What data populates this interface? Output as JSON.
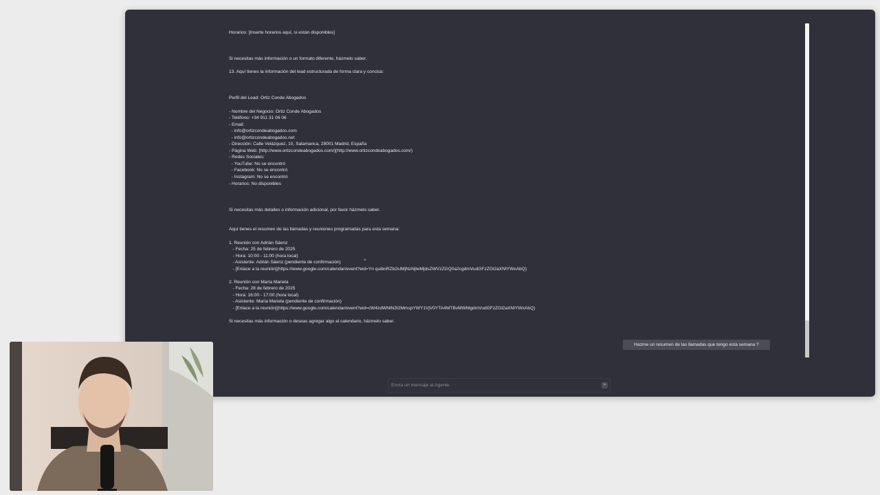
{
  "chat": {
    "messages": [
      "Horarios: [Inserte horarios aquí, si están disponibles]",
      "",
      "",
      "",
      "Si necesitas más información o un formato diferente, házmelo saber.",
      "",
      "13. Aquí tienes la información del lead estructurada de forma clara y concisa:",
      "",
      "",
      "",
      "Perfil del Lead: Ortiz Conde Abogados",
      "",
      "- Nombre del Negocio: Ortiz Conde Abogados",
      "- Teléfono: +34 911 31 06 06",
      "- Email:",
      "  - info@ortizcondeabogados.com",
      "  - info@ortizcondeabogados.net",
      "- Dirección: Calle Velázquez, 10, Salamanca, 28001 Madrid, España",
      "- Página Web: [http://www.ortizcondeabogados.com/](http://www.ortizcondeabogados.com/)",
      "- Redes Sociales:",
      "  - YouTube: No se encontró",
      "  - Facebook: No se encontró",
      "  - Instagram: No se encontró",
      "- Horarios: No disponibles",
      "",
      "",
      "",
      "Si necesitas más detalles o información adicional, por favor házmelo saber.",
      "",
      "",
      "Aquí tienes el resumen de las llamadas y reuniones programadas para esta semana:",
      "",
      "1. Reunión con Adrián Sáenz",
      "   - Fecha: 25 de febrero de 2025",
      "   - Hora: 10:00 - 11:00 (hora local)",
      "   - Asistente: Adrián Sáenz (pendiente de confirmación)",
      "   - [Enlace a la reunión](https://www.google.com/calendar/event?eid=Yn quibnRZb2sIMjNzNjlwMjdsZWVzZGQ0a2cgdmVudGFzZGl2aXNIYWxAbQ)",
      "",
      "2. Reunión con María Mariela",
      "   - Fecha: 28 de febrero de 2025",
      "   - Hora: 16:00 - 17:00 (hora local)",
      "   - Asistente: María Mariela (pendiente de confirmación)",
      "   - [Enlace a la reunión](https://www.google.com/calendar/event?eid=cW4zdWNlN2t2MmspYWY1VjV0YTA4MTBvMWMgdmVudGFzZGl2aXNIYWxAbQ)",
      "",
      "Si necesitas más información o deseas agregar algo al calendario, házmelo saber."
    ],
    "user_message": "Hazme un resumen de las llamadas que tengo esta semana ?"
  },
  "composer": {
    "placeholder": "Envía un mensaje al Agente",
    "value": ""
  },
  "icons": {
    "send": "send-icon",
    "cursor": "mouse-cursor-icon"
  },
  "colors": {
    "window_bg": "#2f3039",
    "page_bg": "#ececec",
    "text": "#e6e7ec",
    "user_bubble_bg": "#4a4c57",
    "scrollbar": "#f4f4f4"
  }
}
